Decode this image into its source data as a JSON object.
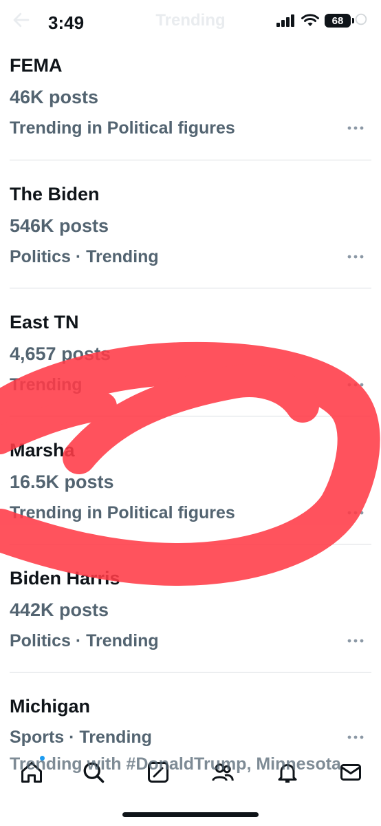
{
  "status": {
    "time": "3:49",
    "battery": "68"
  },
  "header": {
    "title": "Trending"
  },
  "trends": [
    {
      "title": "FEMA",
      "posts": "46K posts",
      "meta": "Trending in Political figures"
    },
    {
      "title": "The Biden",
      "posts": "546K posts",
      "meta": "Politics · Trending"
    },
    {
      "title": "East TN",
      "posts": "4,657 posts",
      "meta": "Trending"
    },
    {
      "title": "Marsha",
      "posts": "16.5K posts",
      "meta": "Trending in Political figures"
    },
    {
      "title": "Biden Harris",
      "posts": "442K posts",
      "meta": "Politics · Trending"
    },
    {
      "title": "Michigan",
      "posts": "",
      "meta": "Sports · Trending"
    }
  ],
  "partial_text": "Trending with #DonaldTrump, Minnesota",
  "nav": {
    "icons": [
      "home-icon",
      "search-icon",
      "compose-icon",
      "communities-icon",
      "notifications-icon",
      "messages-icon"
    ]
  },
  "colors": {
    "annotation": "#ff3b47",
    "muted": "#536471",
    "text": "#0f1419",
    "accent": "#1d9bf0"
  }
}
